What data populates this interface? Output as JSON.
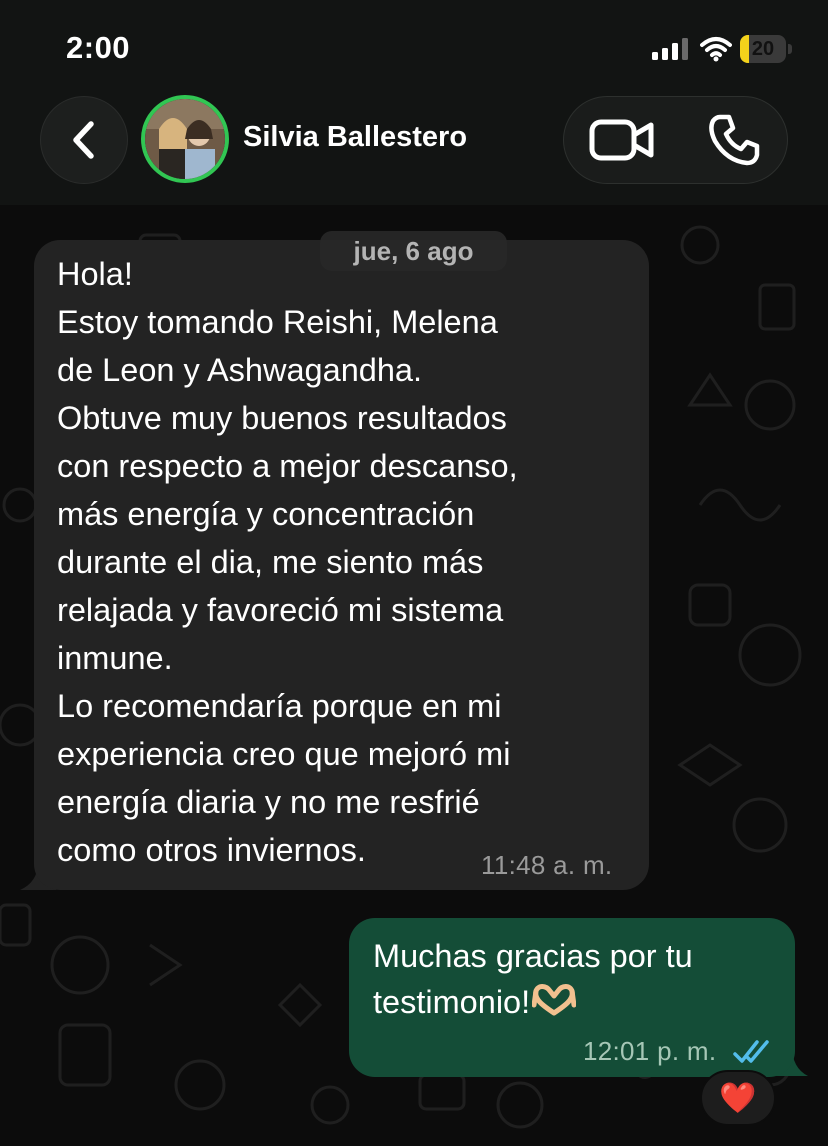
{
  "status_bar": {
    "time": "2:00",
    "battery_level": "20",
    "battery_fraction": 0.2,
    "icons": [
      "cellular-signal-icon",
      "wifi-icon",
      "battery-icon"
    ]
  },
  "header": {
    "back_icon": "chevron-left-icon",
    "contact_name": "Silvia Ballestero",
    "video_icon": "video-camera-icon",
    "call_icon": "phone-icon"
  },
  "chat": {
    "date_separator": "jue, 6 ago",
    "messages": [
      {
        "direction": "incoming",
        "text": "Hola!\nEstoy tomando Reishi, Melena\nde Leon y Ashwagandha.\nObtuve muy buenos resultados\ncon respecto a mejor descanso,\nmás energía y concentración\ndurante el dia, me siento más\nrelajada y favoreció mi sistema\ninmune.\nLo recomendaría porque en mi\nexperiencia creo que mejoró mi\nenergía diaria y no me resfrié\ncomo otros inviernos.",
        "time": "11:48 a. m."
      },
      {
        "direction": "outgoing",
        "text": "Muchas gracias por tu\ntestimonio!",
        "emoji": "heart-hands-emoji",
        "time": "12:01 p. m.",
        "status_icon": "double-check-read-icon",
        "reaction": "❤️"
      }
    ]
  },
  "colors": {
    "background": "#0c0c0c",
    "incoming_bubble": "#232323",
    "outgoing_bubble": "#144d37",
    "read_ticks": "#53bdeb",
    "avatar_ring": "#31c653",
    "battery_low": "#f3d21b"
  }
}
